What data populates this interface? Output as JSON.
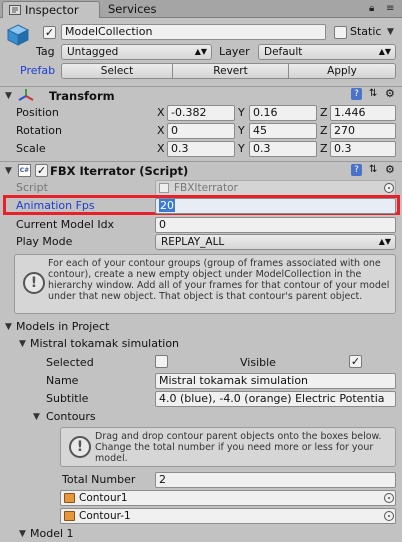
{
  "tabs": [
    {
      "label": "Inspector"
    },
    {
      "label": "Services"
    }
  ],
  "header": {
    "object_name": "ModelCollection",
    "static_label": "Static",
    "tag_label": "Tag",
    "tag_value": "Untagged",
    "layer_label": "Layer",
    "layer_value": "Default",
    "prefab_label": "Prefab",
    "select_label": "Select",
    "revert_label": "Revert",
    "apply_label": "Apply"
  },
  "transform": {
    "title": "Transform",
    "position_label": "Position",
    "rotation_label": "Rotation",
    "scale_label": "Scale",
    "position": {
      "x": "-0.382",
      "y": "0.16",
      "z": "1.446"
    },
    "rotation": {
      "x": "0",
      "y": "45",
      "z": "270"
    },
    "scale": {
      "x": "0.3",
      "y": "0.3",
      "z": "0.3"
    },
    "axis_x": "X",
    "axis_y": "Y",
    "axis_z": "Z"
  },
  "script": {
    "title": "FBX Iterrator (Script)",
    "script_label": "Script",
    "script_value": "FBXIterrator",
    "fps_label": "Animation Fps",
    "fps_value": "20",
    "idx_label": "Current Model Idx",
    "idx_value": "0",
    "play_mode_label": "Play Mode",
    "play_mode_value": "REPLAY_ALL",
    "help_text": "For each of your contour groups (group of frames associated with one contour), create a new empty object under ModelCollection in the hierarchy window. Add all of your frames for that contour of your model under that new object. That object is that contour's parent object."
  },
  "models": {
    "title": "Models in Project",
    "model0": {
      "title": "Mistral tokamak simulation",
      "selected_label": "Selected",
      "visible_label": "Visible",
      "name_label": "Name",
      "name_value": "Mistral tokamak simulation",
      "subtitle_label": "Subtitle",
      "subtitle_value": "4.0 (blue), -4.0 (orange) Electric Potentia",
      "contours_label": "Contours",
      "contours_help": "Drag and drop contour parent objects onto the boxes below. Change the total number if you need more or less for your model.",
      "total_label": "Total Number",
      "total_value": "2",
      "contours": [
        {
          "name": "Contour1"
        },
        {
          "name": "Contour-1"
        }
      ]
    },
    "model1_title": "Model 1"
  },
  "colors": {
    "highlight_border": "#e8202a",
    "selected_label": "#1a3fd1",
    "selection_bg": "#3d7ad6"
  }
}
